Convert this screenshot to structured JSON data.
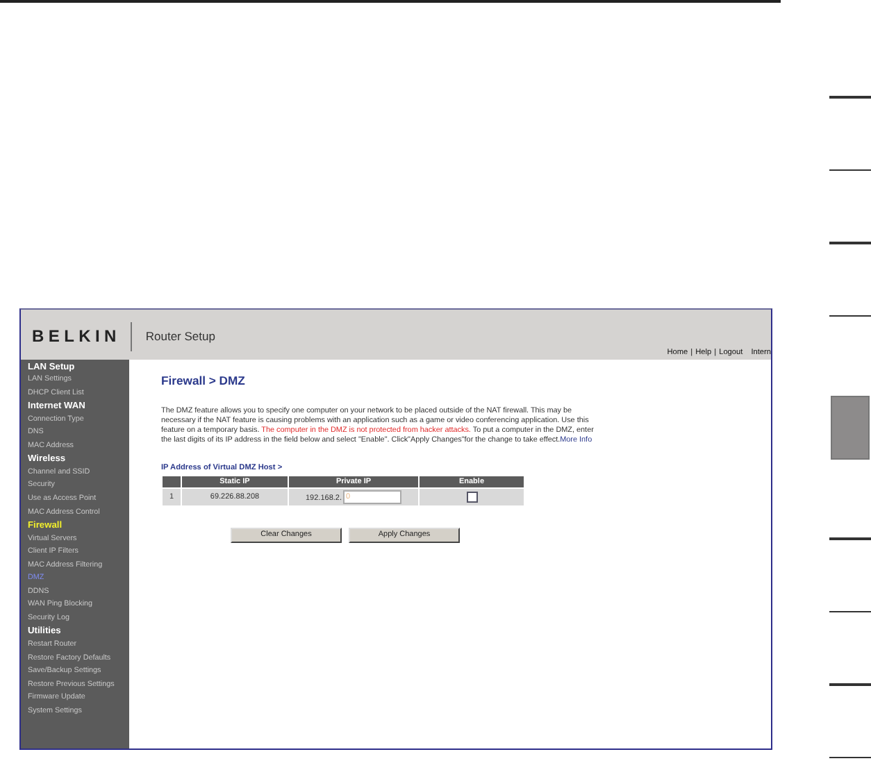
{
  "header": {
    "logo": "BELKIN",
    "title": "Router Setup",
    "nav_links": [
      "Home",
      "Help",
      "Logout"
    ],
    "separator": "|",
    "cut_link": "Intern"
  },
  "sidebar": {
    "items": [
      {
        "label": "LAN Setup",
        "kind": "heading",
        "selected": false
      },
      {
        "label": "LAN Settings",
        "kind": "item",
        "selected": false
      },
      {
        "label": "DHCP Client List",
        "kind": "item",
        "selected": false
      },
      {
        "label": "Internet WAN",
        "kind": "heading",
        "selected": false
      },
      {
        "label": "Connection Type",
        "kind": "item",
        "selected": false
      },
      {
        "label": "DNS",
        "kind": "item",
        "selected": false
      },
      {
        "label": "MAC Address",
        "kind": "item",
        "selected": false
      },
      {
        "label": "Wireless",
        "kind": "heading",
        "selected": false
      },
      {
        "label": "Channel and SSID",
        "kind": "item",
        "selected": false
      },
      {
        "label": "Security",
        "kind": "item",
        "selected": false
      },
      {
        "label": "Use as Access Point",
        "kind": "item",
        "selected": false
      },
      {
        "label": "MAC Address Control",
        "kind": "item",
        "selected": false
      },
      {
        "label": "Firewall",
        "kind": "heading",
        "selected": true
      },
      {
        "label": "Virtual Servers",
        "kind": "item",
        "selected": false
      },
      {
        "label": "Client IP Filters",
        "kind": "item",
        "selected": false
      },
      {
        "label": "MAC Address Filtering",
        "kind": "item",
        "selected": false
      },
      {
        "label": "DMZ",
        "kind": "item",
        "selected": true
      },
      {
        "label": "DDNS",
        "kind": "item",
        "selected": false
      },
      {
        "label": "WAN Ping Blocking",
        "kind": "item",
        "selected": false
      },
      {
        "label": "Security Log",
        "kind": "item",
        "selected": false
      },
      {
        "label": "Utilities",
        "kind": "heading",
        "selected": false
      },
      {
        "label": "Restart Router",
        "kind": "item",
        "selected": false
      },
      {
        "label": "Restore Factory Defaults",
        "kind": "item",
        "selected": false
      },
      {
        "label": "Save/Backup Settings",
        "kind": "item",
        "selected": false
      },
      {
        "label": "Restore Previous Settings",
        "kind": "item",
        "selected": false
      },
      {
        "label": "Firmware Update",
        "kind": "item",
        "selected": false
      },
      {
        "label": "System Settings",
        "kind": "item",
        "selected": false
      }
    ]
  },
  "content": {
    "title": "Firewall > DMZ",
    "description": [
      {
        "kind": "normal",
        "text": "The DMZ feature allows you to specify one computer on your network to be placed outside of the NAT firewall. This may be necessary if the NAT feature is causing problems with an application such as a game or video conferencing application. Use this feature on a temporary basis. "
      },
      {
        "kind": "warning",
        "text": "The computer in the DMZ is not protected from hacker attacks."
      },
      {
        "kind": "normal",
        "text": " To put a computer in the DMZ, enter the last digits of its IP address in the field below and select \"Enable\". Click\"Apply Changes\"for the change to take effect."
      },
      {
        "kind": "link",
        "text": "More Info"
      }
    ],
    "table_title": "IP Address of Virtual DMZ Host >",
    "table": {
      "columns": [
        "Static IP",
        "Private IP",
        "Enable"
      ],
      "rows": [
        {
          "index": "1",
          "static_ip": "69.226.88.208",
          "private_ip_prefix": "192.168.2.",
          "placeholder": "0",
          "enabled": false
        }
      ]
    },
    "buttons": [
      "Clear Changes",
      "Apply Changes"
    ]
  }
}
